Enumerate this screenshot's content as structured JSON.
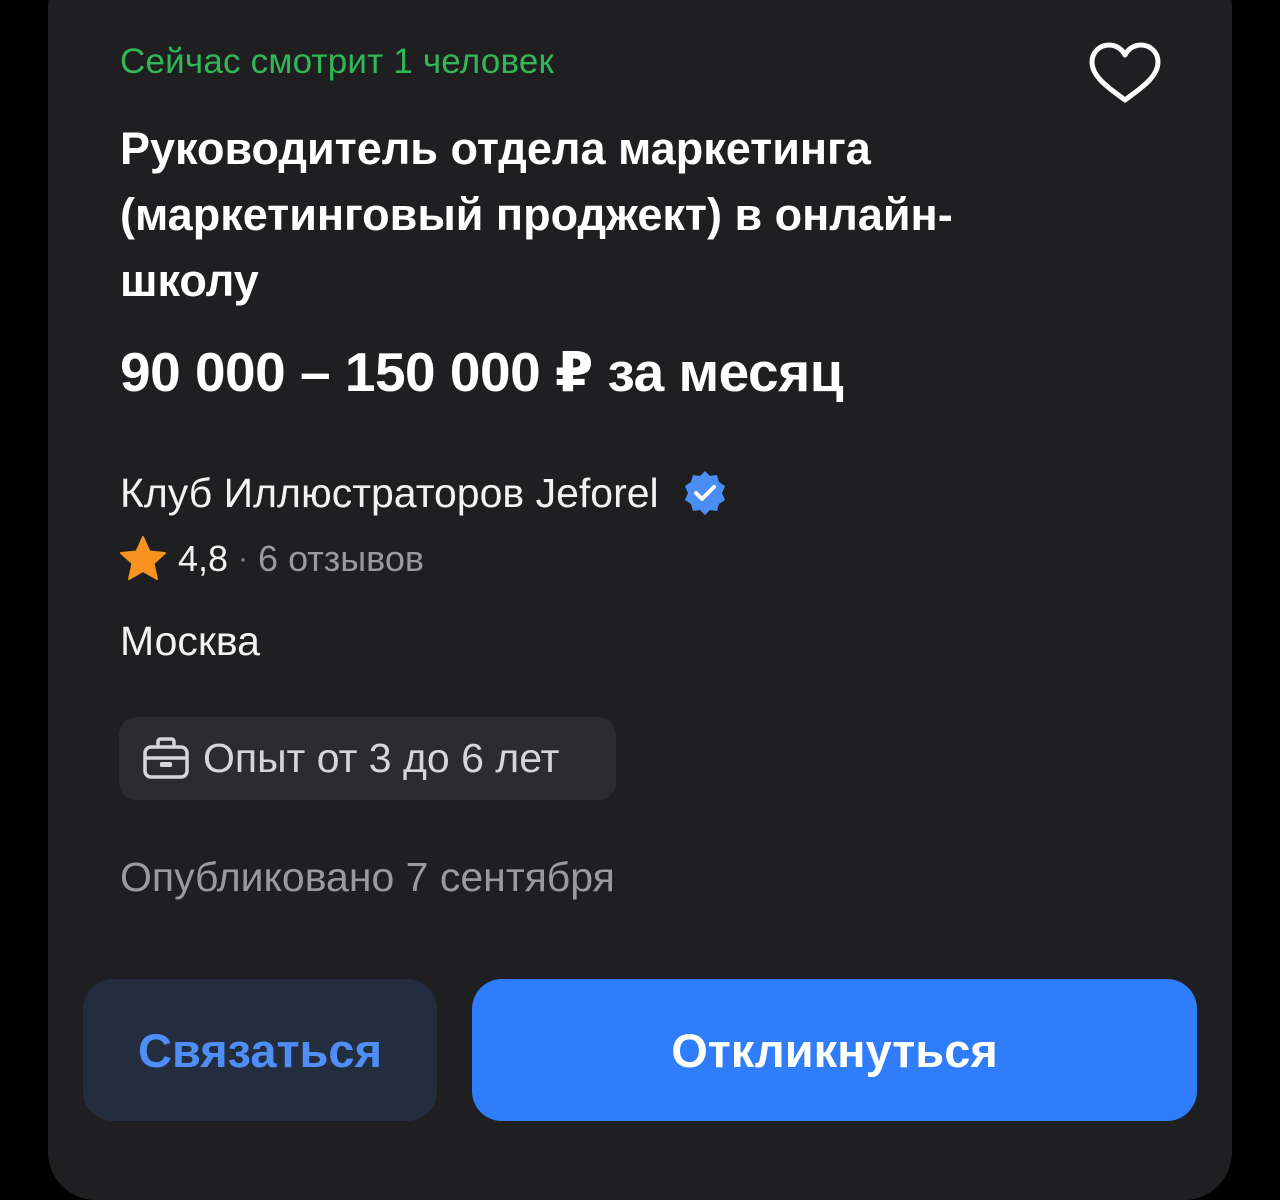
{
  "vacancy": {
    "viewers_text": "Сейчас смотрит 1 человек",
    "title": "Руководитель отдела маркетинга (маркетинговый проджект) в онлайн-школу",
    "salary": "90 000 – 150 000 ₽ за месяц",
    "company": {
      "name": "Клуб Иллюстраторов Jeforel",
      "verified_icon": "verified-check-icon",
      "rating": "4,8",
      "separator": "·",
      "reviews": "6 отзывов",
      "rating_icon": "star-icon"
    },
    "city": "Москва",
    "experience": {
      "icon": "briefcase-icon",
      "label": "Опыт от 3 до 6 лет"
    },
    "published": "Опубликовано 7 сентября",
    "favorite_icon": "heart-icon"
  },
  "actions": {
    "contact_label": "Связаться",
    "apply_label": "Откликнуться"
  },
  "colors": {
    "background": "#1f1f21",
    "viewers_green": "#2fb855",
    "accent_blue": "#2f7dfa",
    "star_orange": "#f7931e"
  }
}
